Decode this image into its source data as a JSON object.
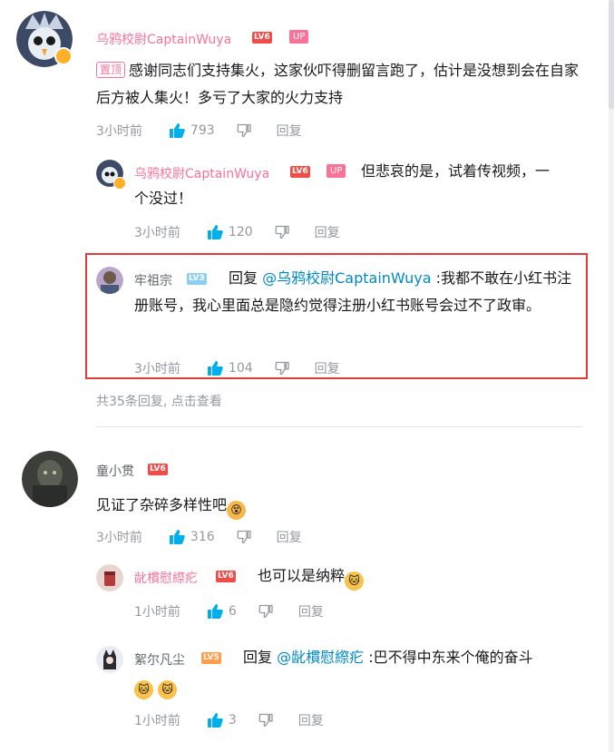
{
  "comments": [
    {
      "user": "乌鸦校尉CaptainWuya",
      "level": "LV6",
      "up_badge": "UP",
      "pinned_label": "置顶",
      "text": "感谢同志们支持集火，这家伙吓得删留言跑了，估计是没想到会在自家后方被人集火！多亏了大家的火力支持",
      "time": "3小时前",
      "likes": "793",
      "reply_label": "回复",
      "replies": [
        {
          "user": "乌鸦校尉CaptainWuya",
          "level": "LV6",
          "up_badge": "UP",
          "text": "但悲哀的是，试着传视频，一个没过！",
          "time": "3小时前",
          "likes": "120",
          "reply_label": "回复"
        },
        {
          "user": "牢祖宗",
          "level": "LV3",
          "reply_prefix": "回复",
          "mention": "@乌鸦校尉CaptainWuya",
          "text": ":我都不敢在小红书注册账号，我心里面总是隐约觉得注册小红书账号会过不了政审。",
          "time": "3小时前",
          "likes": "104",
          "reply_label": "回复"
        }
      ],
      "more_replies": "共35条回复, 点击查看"
    },
    {
      "user": "童小贯",
      "level": "LV6",
      "text": "见证了杂碎多样性吧",
      "time": "3小时前",
      "likes": "316",
      "reply_label": "回复",
      "replies": [
        {
          "user": "龀樌慰縩疕",
          "level": "LV6",
          "text": "也可以是纳粹",
          "time": "1小时前",
          "likes": "6",
          "reply_label": "回复"
        },
        {
          "user": "絮尔凡尘",
          "level": "LV5",
          "reply_prefix": "回复",
          "mention": "@龀樌慰縩疕",
          "text": ":巴不得中东来个俺的奋斗",
          "time": "1小时前",
          "likes": "3",
          "reply_label": "回复"
        }
      ]
    }
  ],
  "icons": {
    "like": "thumbs-up-icon",
    "dislike": "thumbs-down-icon",
    "emoji": "cat-emoji-icon"
  },
  "colors": {
    "up_pink": "#fb7299",
    "mention_blue": "#008ac5",
    "like_blue": "#00aeec",
    "highlight_red": "#e33a3a",
    "meta_gray": "#9499a0"
  }
}
